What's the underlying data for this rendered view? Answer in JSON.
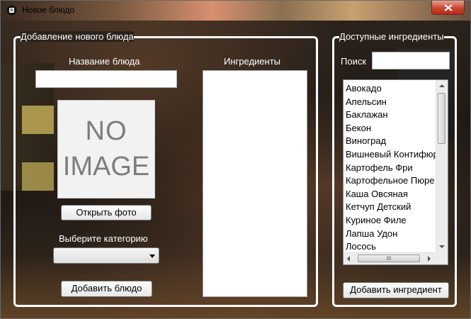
{
  "window": {
    "title": "Новое блюдо",
    "close_symbol": "X"
  },
  "add_group": {
    "legend": "Добавление нового блюда",
    "dish_name_label": "Название блюда",
    "dish_name_value": "",
    "ingredients_label": "Ингредиенты",
    "image_placeholder_line1": "NO",
    "image_placeholder_line2": "IMAGE",
    "open_photo_button": "Открыть фото",
    "category_label": "Выберите категорию",
    "category_value": "",
    "add_dish_button": "Добавить блюдо"
  },
  "available_group": {
    "legend": "Доступные ингредиенты",
    "search_label": "Поиск",
    "search_value": "",
    "items": [
      "Авокадо",
      "Апельсин",
      "Баклажан",
      "Бекон",
      "Виноград",
      "Вишневый Контифюр",
      "Картофель Фри",
      "Картофельное Пюре",
      "Каша Овсяная",
      "Кетчуп Детский",
      "Куриное Филе",
      "Лапша Удон",
      "Лосось"
    ],
    "add_ingredient_button": "Добавить ингредиент",
    "scroll_grip": "III"
  },
  "colors": {
    "groupbox_border": "#ffffff",
    "close_button": "#c8402a"
  }
}
